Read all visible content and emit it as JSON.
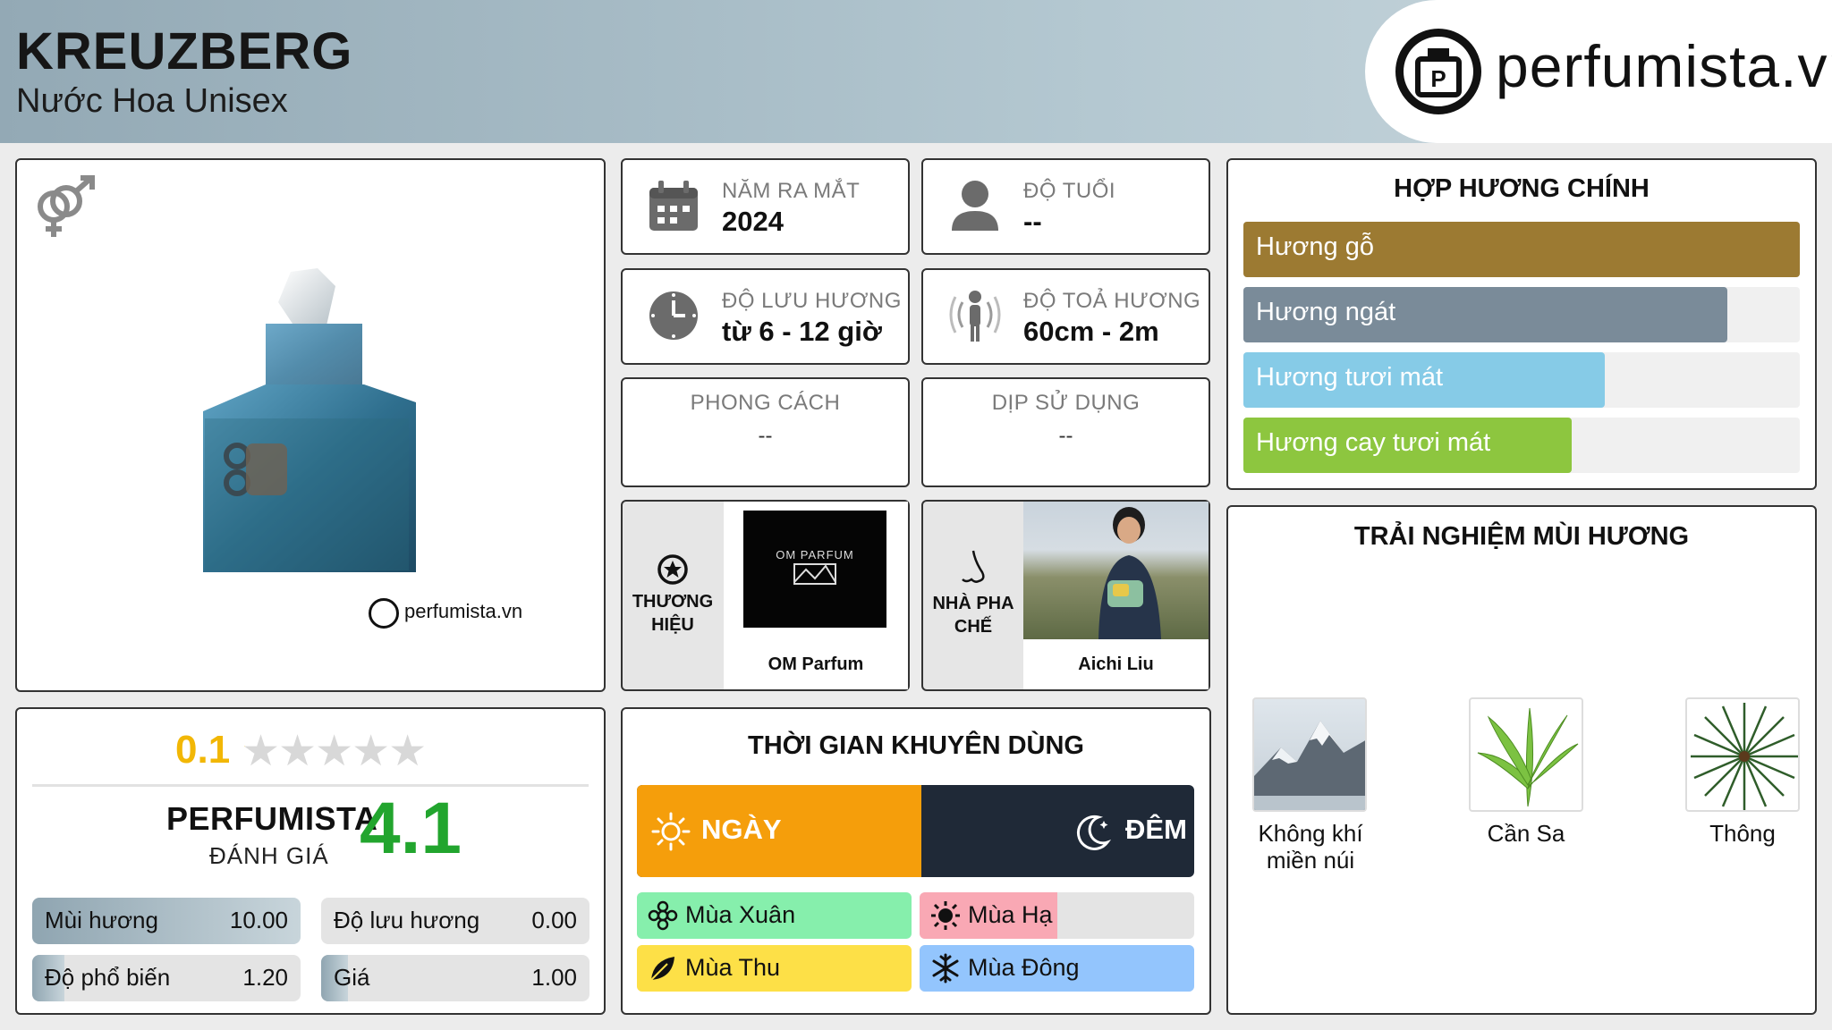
{
  "header": {
    "title": "KREUZBERG",
    "subtitle": "Nước Hoa Unisex",
    "brand": "perfumista.vn"
  },
  "info": {
    "release": {
      "label": "NĂM RA MẮT",
      "value": "2024"
    },
    "age": {
      "label": "ĐỘ TUỔI",
      "value": "--"
    },
    "longevity": {
      "label": "ĐỘ LƯU HƯƠNG",
      "value": "từ 6 - 12 giờ"
    },
    "sillage": {
      "label": "ĐỘ TOẢ HƯƠNG",
      "value": "60cm - 2m"
    },
    "style": {
      "label": "PHONG CÁCH",
      "value": "--"
    },
    "occasion": {
      "label": "DỊP SỬ DỤNG",
      "value": "--"
    },
    "brand": {
      "label": "THƯƠNG HIỆU",
      "name": "OM Parfum",
      "logo_text": "OM PARFUM"
    },
    "perfumer": {
      "label": "NHÀ PHA CHẾ",
      "name": "Aichi Liu"
    }
  },
  "product": {
    "watermark": "perfumista.vn"
  },
  "accords": {
    "title": "HỢP HƯƠNG CHÍNH",
    "items": [
      {
        "label": "Hương gỗ",
        "percent": 100,
        "color": "#9c7a32"
      },
      {
        "label": "Hương ngát",
        "percent": 87,
        "color": "#7a8b99"
      },
      {
        "label": "Hương tươi mát",
        "percent": 65,
        "color": "#86cbe7"
      },
      {
        "label": "Hương cay tươi mát",
        "percent": 59,
        "color": "#8dc63f"
      }
    ]
  },
  "experience": {
    "title": "TRẢI NGHIỆM MÙI HƯƠNG",
    "notes": [
      {
        "label": "Không khí miền núi",
        "icon": "mountain-image"
      },
      {
        "label": "Cần Sa",
        "icon": "cannabis-leaf-image"
      },
      {
        "label": "Thông",
        "icon": "pine-image"
      }
    ]
  },
  "rating": {
    "user_score": "0.1",
    "stars_filled": 0.1,
    "label_main": "PERFUMISTA",
    "label_sub": "ĐÁNH GIÁ",
    "score": "4.1",
    "stats": [
      {
        "label": "Mùi hương",
        "value": "10.00",
        "fill": 1.0
      },
      {
        "label": "Độ lưu hương",
        "value": "0.00",
        "fill": 0.0
      },
      {
        "label": "Độ phổ biến",
        "value": "1.20",
        "fill": 0.12
      },
      {
        "label": "Giá",
        "value": "1.00",
        "fill": 0.1
      }
    ]
  },
  "time": {
    "title": "THỜI GIAN KHUYÊN DÙNG",
    "day": "NGÀY",
    "night": "ĐÊM",
    "day_share": 0.51,
    "colors": {
      "day": "#f59e0b",
      "night": "#1f2937"
    },
    "seasons": [
      {
        "label": "Mùa Xuân",
        "fill": 1.0,
        "color": "#86efac"
      },
      {
        "label": "Mùa Hạ",
        "fill": 0.5,
        "color": "#f9a8b4"
      },
      {
        "label": "Mùa Thu",
        "fill": 1.0,
        "color": "#fde047"
      },
      {
        "label": "Mùa Đông",
        "fill": 1.0,
        "color": "#93c5fd"
      }
    ]
  }
}
